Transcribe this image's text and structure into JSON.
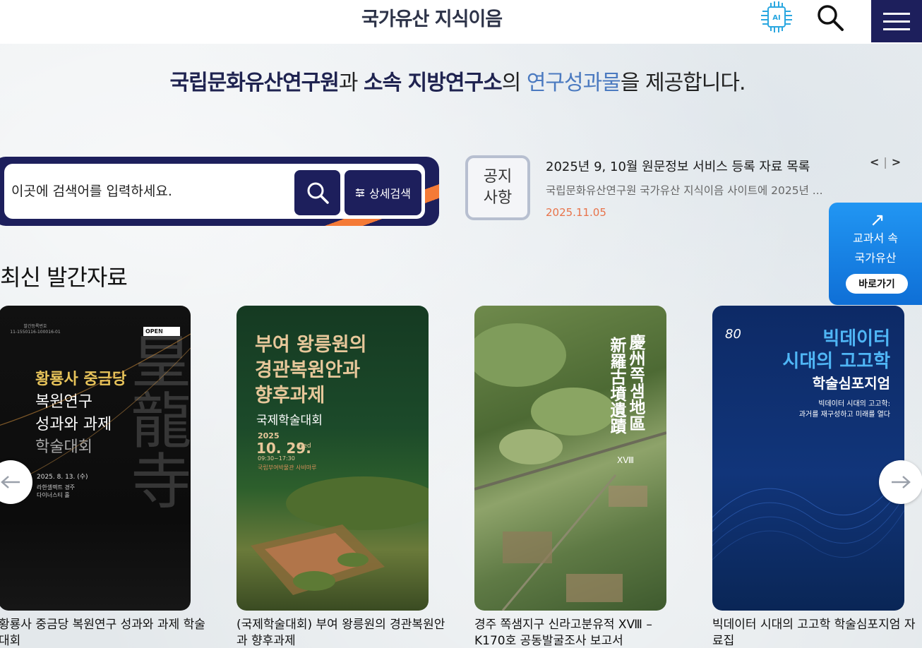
{
  "header": {
    "logo": "국가유산 지식이음",
    "ai_label": "AI"
  },
  "tagline": {
    "part1": "국립문화유산연구원",
    "part2": "과 ",
    "part3": "소속 지방연구소",
    "part4": "의 ",
    "part5": "연구성과물",
    "part6": "을 제공합니다."
  },
  "search": {
    "placeholder": "이곳에 검색어를 입력하세요.",
    "advanced_label": "상세검색"
  },
  "notice": {
    "badge_line1": "공지",
    "badge_line2": "사항",
    "title": "2025년 9, 10월 원문정보 서비스 등록 자료 목록",
    "description": "국립문화유산연구원 국가유산 지식이음 사이트에 2025년 ...",
    "date": "2025.11.05",
    "prev": "<",
    "separator": "|",
    "next": ">"
  },
  "side_banner": {
    "line1": "교과서 속",
    "line2": "국가유산",
    "button": "바로가기"
  },
  "section": {
    "title": "최신 발간자료"
  },
  "cards": [
    {
      "caption": "황룡사 중금당 복원연구 성과와 과제 학술대회",
      "poster": {
        "pub_no": "발간등록번호\n11-1550116-100016-01",
        "open_badge": "OPEN",
        "line1": "황룡사 중금당",
        "line2": "복원연구",
        "line3": "성과와 과제",
        "line4": "학술대회",
        "hanja": "皇龍寺",
        "date": "2025. 8. 13. (수)",
        "venue": "라한셀렉트 경주\n다이너스티 홀"
      }
    },
    {
      "caption": "(국제학술대회) 부여 왕릉원의 경관복원안과 향후과제",
      "poster": {
        "line1": "부여 왕릉원의",
        "line2": "경관복원안과",
        "line3": "향후과제",
        "line4": "국제학술대회",
        "year": "2025",
        "date": "10. 29.",
        "day": "Wed",
        "time": "09:30~17:30",
        "venue": "국립부여박물관 사비마루"
      }
    },
    {
      "caption": "경주 쪽샘지구 신라고분유적 XⅧ – K170호 공동발굴조사 보고서",
      "poster": {
        "col1": "慶州",
        "col1b": "쪽샘",
        "col1c": "地區",
        "col2": "新羅古墳遺蹟",
        "volume": "XⅧ"
      }
    },
    {
      "caption": "빅데이터 시대의 고고학 학술심포지엄 자료집",
      "poster": {
        "anniv": "80",
        "line1": "빅데이터",
        "line2": "시대의 고고학",
        "line3": "학술심포지엄",
        "sub1": "빅데이터 시대의 고고학:",
        "sub2": "과거를 재구성하고 미래를 열다"
      }
    }
  ],
  "colors": {
    "navy": "#1d1f5c",
    "orange": "#f47a36",
    "blue_text": "#4b7ac0",
    "banner_blue": "#2196f3",
    "date_orange": "#e8734a"
  }
}
